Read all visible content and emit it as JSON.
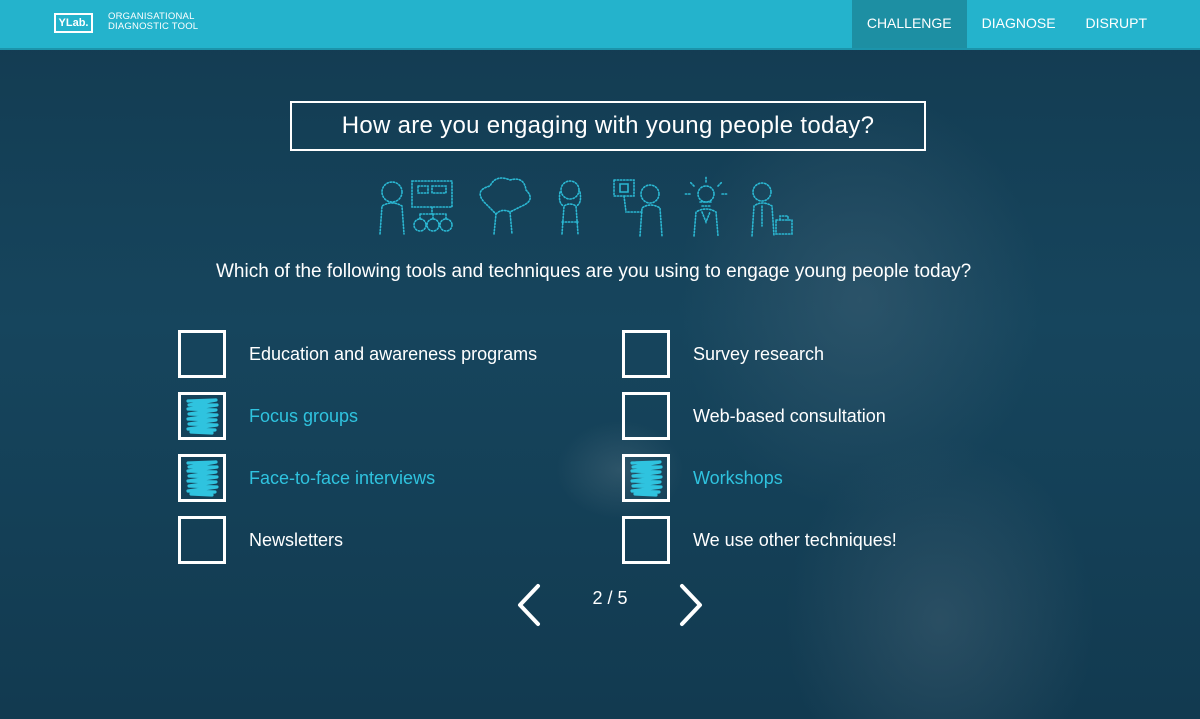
{
  "header": {
    "logo": "YLab.",
    "logo_line1": "ORGANISATIONAL",
    "logo_line2": "DIAGNOSTIC TOOL",
    "nav": [
      {
        "label": "CHALLENGE",
        "active": true
      },
      {
        "label": "DIAGNOSE",
        "active": false
      },
      {
        "label": "DISRUPT",
        "active": false
      }
    ]
  },
  "main": {
    "title": "How are you engaging with young people today?",
    "question": "Which of the following tools and techniques are you using to engage young people today?",
    "options": [
      {
        "label": "Education and awareness programs",
        "checked": false
      },
      {
        "label": "Survey research",
        "checked": false
      },
      {
        "label": "Focus groups",
        "checked": true
      },
      {
        "label": "Web-based consultation",
        "checked": false
      },
      {
        "label": "Face-to-face interviews",
        "checked": true
      },
      {
        "label": "Workshops",
        "checked": true
      },
      {
        "label": "Newsletters",
        "checked": false
      },
      {
        "label": "We use other techniques!",
        "checked": false
      }
    ]
  },
  "pager": {
    "indicator": "2 / 5",
    "prev_icon": "chevron-left-icon",
    "next_icon": "chevron-right-icon"
  },
  "colors": {
    "header_bg": "#24b3cc",
    "active_nav_bg": "#1d8fa3",
    "checked_accent": "#2fc3df",
    "page_bg": "#143f55"
  }
}
